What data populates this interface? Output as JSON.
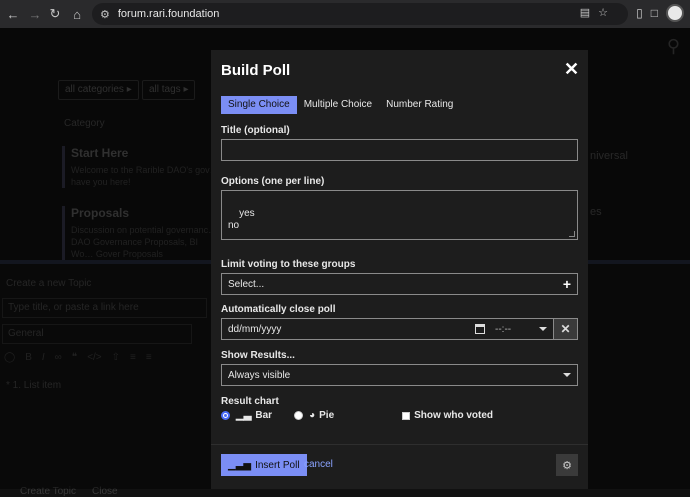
{
  "browser": {
    "url": "forum.rari.foundation"
  },
  "background": {
    "filters": [
      "all categories ▸",
      "all tags ▸"
    ],
    "category_header": "Category",
    "categories": [
      {
        "title": "Start Here",
        "desc": "Welcome to the Rarible DAO's gov… have you here!"
      },
      {
        "title": "Proposals",
        "desc": "Discussion on potential governanc… DAO Governance Proposals, BI Wo… Gover Proposals"
      }
    ],
    "right_fragment": "niversal",
    "right_fragment2": "es",
    "composer": {
      "header": "Create a new Topic",
      "title_placeholder": "Type title, or paste a link here",
      "category_value": "General",
      "body_text": "* 1. List item",
      "bottom_left": "Create Topic",
      "bottom_close": "Close"
    }
  },
  "modal": {
    "title": "Build Poll",
    "tabs": [
      {
        "label": "Single Choice",
        "active": true
      },
      {
        "label": "Multiple Choice",
        "active": false
      },
      {
        "label": "Number Rating",
        "active": false
      }
    ],
    "title_field": {
      "label": "Title (optional)",
      "value": ""
    },
    "options_field": {
      "label": "Options (one per line)",
      "value": "yes\nno"
    },
    "groups_field": {
      "label": "Limit voting to these groups",
      "value": "Select..."
    },
    "close_poll": {
      "label": "Automatically close poll",
      "date_value": "dd/mm/yyyy",
      "time_value": "--:--"
    },
    "show_results": {
      "label": "Show Results...",
      "value": "Always visible"
    },
    "result_chart": {
      "label": "Result chart",
      "bar_label": "Bar",
      "pie_label": "Pie",
      "selected": "Bar",
      "show_who_voted_label": "Show who voted",
      "show_who_voted": false
    },
    "insert_label": "Insert Poll",
    "cancel_label": "cancel"
  },
  "colors": {
    "accent": "#7b8ef5",
    "link": "#8aa3ff",
    "modal_bg": "#1d1d1d"
  }
}
